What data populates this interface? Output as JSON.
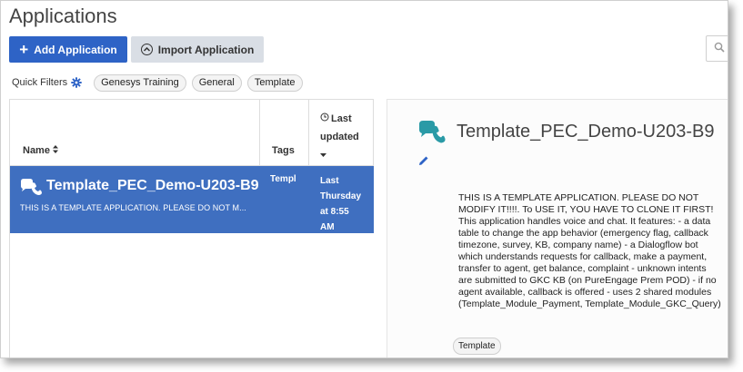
{
  "header": {
    "title": "Applications"
  },
  "toolbar": {
    "add_label": "Add Application",
    "import_label": "Import Application",
    "search_icon": "search-icon"
  },
  "quick_filters": {
    "label": "Quick Filters",
    "chips": [
      "Genesys Training",
      "General",
      "Template"
    ]
  },
  "table": {
    "columns": {
      "name": "Name",
      "tags": "Tags",
      "last_updated": "Last updated"
    },
    "rows": [
      {
        "name": "Template_PEC_Demo-U203-B9",
        "description": "THIS IS A TEMPLATE APPLICATION. PLEASE DO NOT M...",
        "tags": "Templ",
        "updated_line1": "Last",
        "updated_line2": "Thursday",
        "updated_line3": "at 8:55",
        "updated_line4": "AM",
        "selected": true
      }
    ]
  },
  "detail": {
    "title": "Template_PEC_Demo-U203-B9",
    "description": "THIS IS A TEMPLATE APPLICATION. PLEASE DO NOT MODIFY IT!!!!. To USE IT, YOU HAVE TO CLONE IT FIRST! This application handles voice and chat. It features: - a data table to change the app behavior (emergency flag, callback timezone, survey, KB, company name) - a Dialogflow bot which understands requests for callback, make a payment, transfer to agent, get balance, complaint - unknown intents are submitted to GKC KB (on PureEngage Prem POD) - if no agent available, callback is offered - uses 2 shared modules (Template_Module_Payment, Template_Module_GKC_Query)",
    "tag": "Template"
  },
  "colors": {
    "primary": "#2e63c6",
    "selected_row": "#3f6fc0",
    "icon_teal": "#2a9aa6"
  }
}
